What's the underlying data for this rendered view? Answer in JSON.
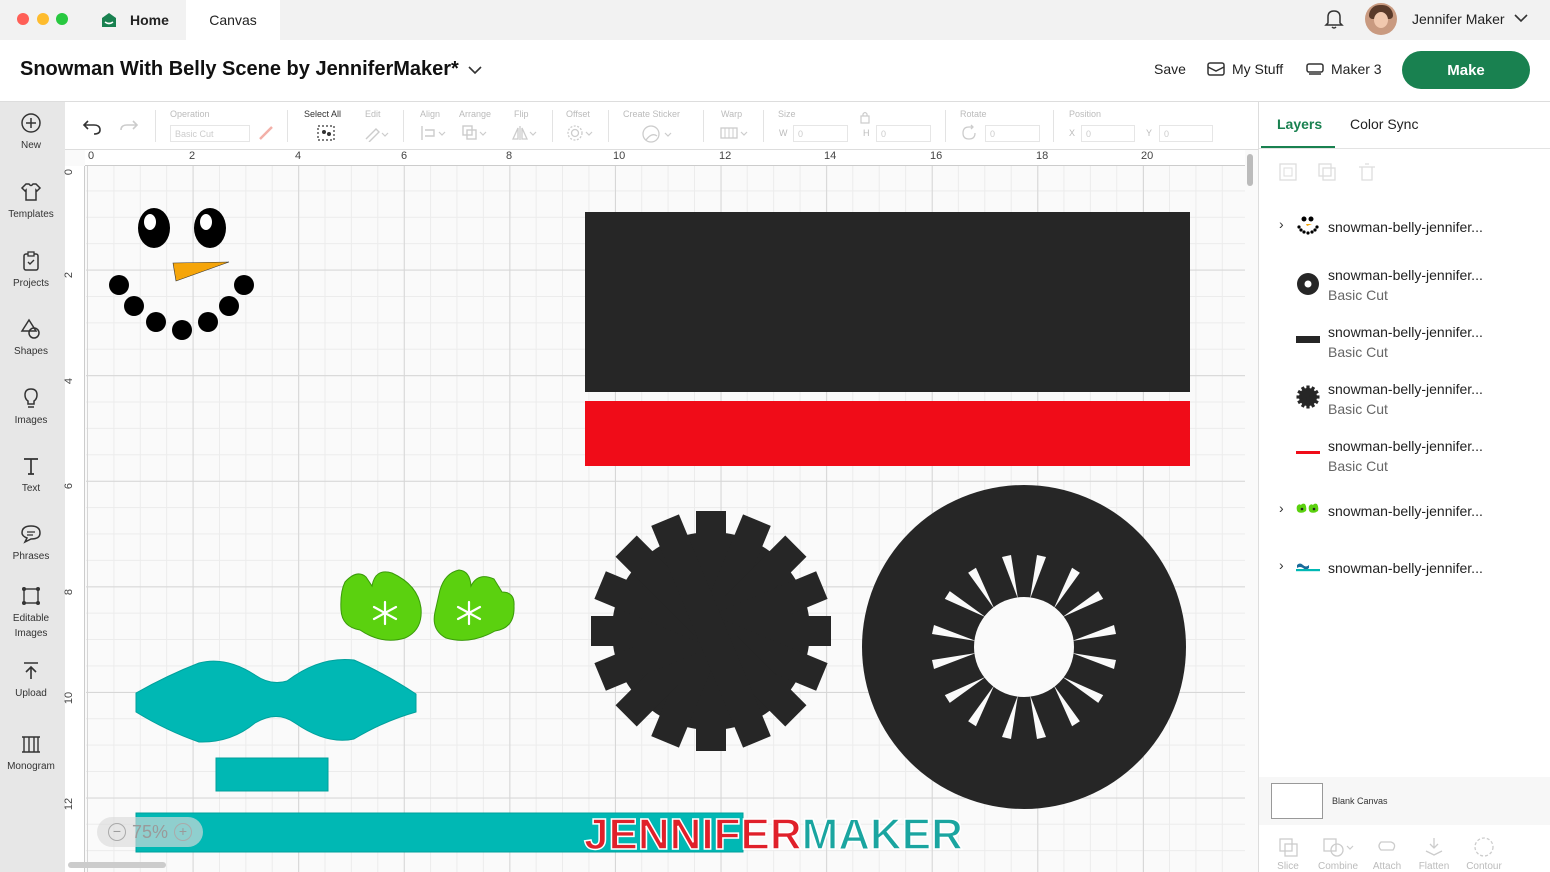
{
  "tabs": {
    "home": "Home",
    "canvas": "Canvas"
  },
  "user": {
    "name": "Jennifer Maker"
  },
  "project": {
    "title": "Snowman With Belly Scene by JenniferMaker*"
  },
  "header": {
    "save": "Save",
    "my_stuff": "My Stuff",
    "machine": "Maker 3",
    "make": "Make"
  },
  "sidebar": {
    "items": [
      {
        "label": "New",
        "icon": "plus-circle-icon"
      },
      {
        "label": "Templates",
        "icon": "shirt-icon"
      },
      {
        "label": "Projects",
        "icon": "clipboard-icon"
      },
      {
        "label": "Shapes",
        "icon": "shapes-icon"
      },
      {
        "label": "Images",
        "icon": "lightbulb-icon"
      },
      {
        "label": "Text",
        "icon": "text-icon"
      },
      {
        "label": "Phrases",
        "icon": "speech-bubble-icon"
      },
      {
        "label": "Editable",
        "label2": "Images",
        "icon": "editable-image-icon"
      },
      {
        "label": "Upload",
        "icon": "upload-icon"
      },
      {
        "label": "Monogram",
        "icon": "monogram-icon"
      }
    ]
  },
  "toolbar": {
    "operation": "Operation",
    "operation_value": "Basic Cut",
    "select_all": "Select All",
    "edit": "Edit",
    "align": "Align",
    "arrange": "Arrange",
    "flip": "Flip",
    "offset": "Offset",
    "create_sticker": "Create Sticker",
    "warp": "Warp",
    "size": "Size",
    "size_w": "W",
    "size_w_val": "0",
    "size_h": "H",
    "size_h_val": "0",
    "rotate": "Rotate",
    "rotate_val": "0",
    "position": "Position",
    "pos_x": "X",
    "pos_x_val": "0",
    "pos_y": "Y",
    "pos_y_val": "0"
  },
  "ruler": {
    "top": [
      "0",
      "2",
      "4",
      "6",
      "8",
      "10",
      "12",
      "14",
      "16",
      "18",
      "20"
    ],
    "left": [
      "0",
      "2",
      "4",
      "6",
      "8",
      "10",
      "12"
    ]
  },
  "canvas": {
    "zoom": "75%",
    "watermark_part1": "JENNIFER",
    "watermark_part2": "MAKER",
    "colors": {
      "black": "#262626",
      "red": "#f00c18",
      "green": "#5bd10f",
      "teal": "#00b8b4",
      "orange": "#f5a50a"
    }
  },
  "panel": {
    "tab_layers": "Layers",
    "tab_color_sync": "Color Sync",
    "layers": [
      {
        "name": "snowman-belly-jennifer...",
        "sub": "",
        "expandable": true,
        "thumb": "snowman-face-thumb"
      },
      {
        "name": "snowman-belly-jennifer...",
        "sub": "Basic Cut",
        "expandable": false,
        "thumb": "ring-thumb"
      },
      {
        "name": "snowman-belly-jennifer...",
        "sub": "Basic Cut",
        "expandable": false,
        "thumb": "black-rect-thumb"
      },
      {
        "name": "snowman-belly-jennifer...",
        "sub": "Basic Cut",
        "expandable": false,
        "thumb": "gear-thumb"
      },
      {
        "name": "snowman-belly-jennifer...",
        "sub": "Basic Cut",
        "expandable": false,
        "thumb": "red-rect-thumb"
      },
      {
        "name": "snowman-belly-jennifer...",
        "sub": "",
        "expandable": true,
        "thumb": "mittens-thumb"
      },
      {
        "name": "snowman-belly-jennifer...",
        "sub": "",
        "expandable": true,
        "thumb": "scarf-thumb"
      }
    ],
    "blank_canvas": "Blank Canvas",
    "actions": [
      "Slice",
      "Combine",
      "Attach",
      "Flatten",
      "Contour"
    ]
  }
}
